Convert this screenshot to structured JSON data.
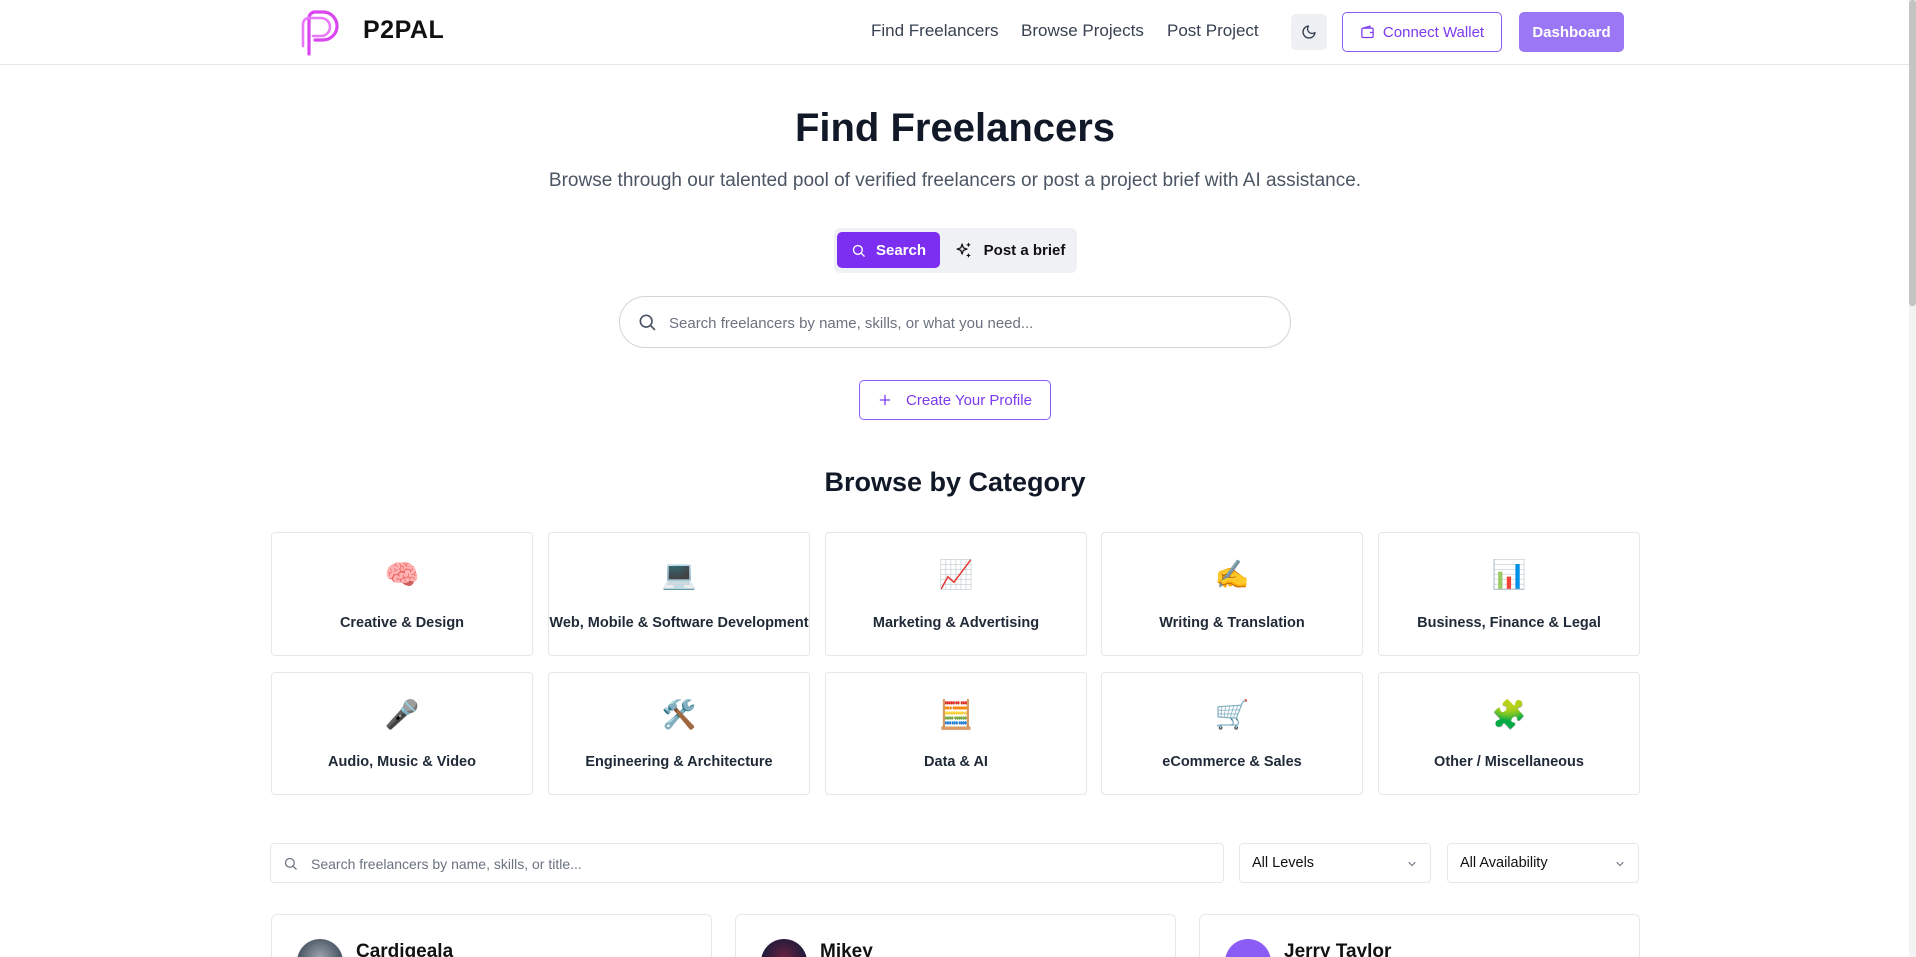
{
  "header": {
    "brand": "P2PAL",
    "nav": [
      "Find Freelancers",
      "Browse Projects",
      "Post Project"
    ],
    "connect_wallet": "Connect Wallet",
    "dashboard": "Dashboard"
  },
  "hero": {
    "title": "Find Freelancers",
    "subtitle": "Browse through our talented pool of verified freelancers or post a project brief with AI assistance.",
    "toggle_search": "Search",
    "toggle_brief": "Post a brief",
    "search_placeholder": "Search freelancers by name, skills, or what you need...",
    "create_profile": "Create Your Profile"
  },
  "categories": {
    "title": "Browse by Category",
    "items": [
      {
        "emoji": "🧠",
        "label": "Creative & Design"
      },
      {
        "emoji": "💻",
        "label": "Web, Mobile & Software Development"
      },
      {
        "emoji": "📈",
        "label": "Marketing & Advertising"
      },
      {
        "emoji": "✍️",
        "label": "Writing & Translation"
      },
      {
        "emoji": "📊",
        "label": "Business, Finance & Legal"
      },
      {
        "emoji": "🎤",
        "label": "Audio, Music & Video"
      },
      {
        "emoji": "🛠️",
        "label": "Engineering & Architecture"
      },
      {
        "emoji": "🧮",
        "label": "Data & AI"
      },
      {
        "emoji": "🛒",
        "label": "eCommerce & Sales"
      },
      {
        "emoji": "🧩",
        "label": "Other / Miscellaneous"
      }
    ]
  },
  "filters": {
    "search_placeholder": "Search freelancers by name, skills, or title...",
    "level": "All Levels",
    "availability": "All Availability"
  },
  "freelancers": [
    {
      "name": "Cardigeala"
    },
    {
      "name": "Mikey"
    },
    {
      "name": "Jerry Taylor"
    }
  ],
  "colors": {
    "accent": "#7c2ff0",
    "accent_light": "#9b77f5",
    "border": "#e5e7eb"
  }
}
